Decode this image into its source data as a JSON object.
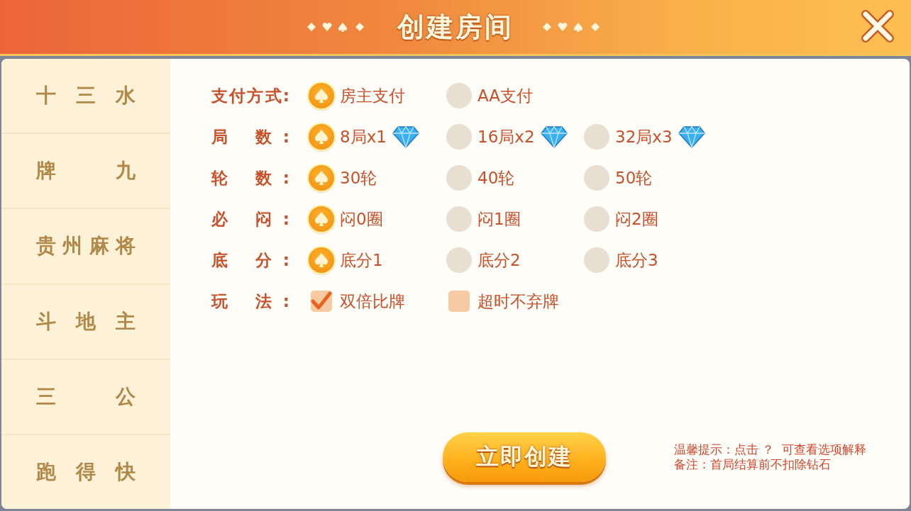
{
  "header": {
    "title": "创建房间"
  },
  "sidebar": {
    "items": [
      {
        "label": "十 三 水",
        "selected": false
      },
      {
        "label": "牌 九",
        "selected": false
      },
      {
        "label": "贵州麻将",
        "selected": false
      },
      {
        "label": "斗 地 主",
        "selected": false
      },
      {
        "label": "三 公",
        "selected": false
      },
      {
        "label": "跑 得 快",
        "selected": false
      }
    ]
  },
  "settings": [
    {
      "label": "支付方式:",
      "kind": "radio",
      "options": [
        {
          "text": "房主支付",
          "selected": true,
          "gem": false
        },
        {
          "text": "AA支付",
          "selected": false,
          "gem": false
        }
      ]
    },
    {
      "label": "局 数:",
      "kind": "radio",
      "options": [
        {
          "text": "8局x1",
          "selected": true,
          "gem": true
        },
        {
          "text": "16局x2",
          "selected": false,
          "gem": true
        },
        {
          "text": "32局x3",
          "selected": false,
          "gem": true
        }
      ]
    },
    {
      "label": "轮 数:",
      "kind": "radio",
      "options": [
        {
          "text": "30轮",
          "selected": true,
          "gem": false
        },
        {
          "text": "40轮",
          "selected": false,
          "gem": false
        },
        {
          "text": "50轮",
          "selected": false,
          "gem": false
        }
      ]
    },
    {
      "label": "必 闷:",
      "kind": "radio",
      "options": [
        {
          "text": "闷0圈",
          "selected": true,
          "gem": false
        },
        {
          "text": "闷1圈",
          "selected": false,
          "gem": false
        },
        {
          "text": "闷2圈",
          "selected": false,
          "gem": false
        }
      ]
    },
    {
      "label": "底 分:",
      "kind": "radio",
      "options": [
        {
          "text": "底分1",
          "selected": true,
          "gem": false
        },
        {
          "text": "底分2",
          "selected": false,
          "gem": false
        },
        {
          "text": "底分3",
          "selected": false,
          "gem": false
        }
      ]
    },
    {
      "label": "玩 法:",
      "kind": "checkbox",
      "options": [
        {
          "text": "双倍比牌",
          "checked": true,
          "gem": false
        },
        {
          "text": "超时不弃牌",
          "checked": false,
          "gem": false
        }
      ]
    }
  ],
  "create_button": "立即创建",
  "notes": [
    "温馨提示：点击 ？  可查看选项解释",
    "备注：首局结算前不扣除钻石"
  ]
}
